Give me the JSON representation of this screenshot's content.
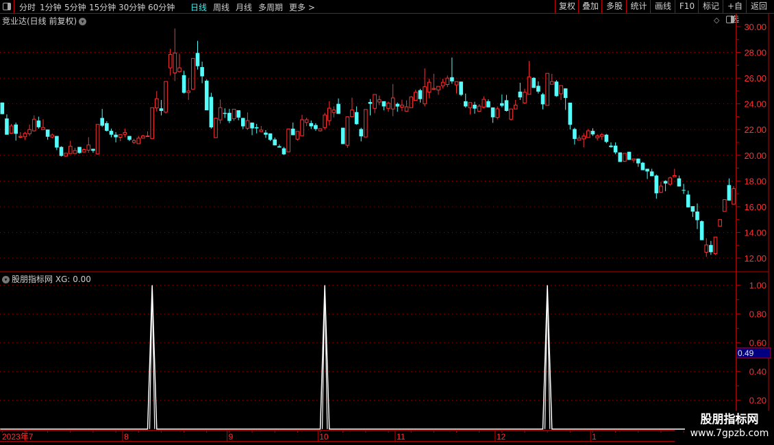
{
  "toolbar": {
    "periods": [
      "分时",
      "1分钟",
      "5分钟",
      "15分钟",
      "30分钟",
      "60分钟",
      "日线",
      "周线",
      "月线",
      "多周期",
      "更多 >"
    ],
    "active_period": "日线",
    "buttons": [
      "复权",
      "叠加",
      "多股",
      "统计",
      "画线",
      "F10",
      "标记",
      "+自选",
      "返回"
    ]
  },
  "chart_title": "竞业达(日线 前复权)",
  "indicator_title": "股朋指标网",
  "indicator_value": "XG: 0.00",
  "cursor_value": "0.49",
  "watermark": {
    "name": "股朋指标网",
    "url": "www.7gpzb.com"
  },
  "colors": {
    "up": "#ff3232",
    "down": "#54fcfc",
    "axis": "#c00000",
    "grid": "#a00000",
    "line": "#ffffff",
    "highlight": "#000080"
  },
  "chart_data": [
    {
      "type": "candlestick",
      "title": "竞业达(日线 前复权)",
      "ylim": [
        12,
        30
      ],
      "yticks": [
        "30.00",
        "28.00",
        "26.00",
        "24.00",
        "22.00",
        "20.00",
        "18.00",
        "16.00",
        "14.00",
        "12.00"
      ],
      "grid": true,
      "ohlc_format": [
        "open",
        "high",
        "low",
        "close"
      ],
      "ohlc": [
        [
          24.1,
          24.1,
          23.2,
          23.2
        ],
        [
          22.86,
          23.18,
          21.6,
          21.6
        ],
        [
          21.72,
          22.44,
          21.67,
          22.28
        ],
        [
          22.39,
          22.54,
          21.14,
          21.67
        ],
        [
          21.4,
          21.8,
          21.33,
          21.47
        ],
        [
          21.44,
          21.82,
          21.19,
          21.7
        ],
        [
          21.67,
          22.39,
          21.5,
          22.0
        ],
        [
          21.9,
          23.1,
          21.85,
          22.8
        ],
        [
          22.7,
          23.0,
          22.07,
          22.18
        ],
        [
          22.0,
          22.8,
          21.95,
          22.16
        ],
        [
          22.0,
          22.0,
          21.2,
          21.44
        ],
        [
          21.42,
          21.7,
          21.3,
          21.58
        ],
        [
          21.5,
          21.5,
          20.4,
          20.6
        ],
        [
          20.65,
          20.7,
          19.9,
          19.95
        ],
        [
          19.93,
          20.16,
          19.9,
          20.16
        ],
        [
          20.14,
          21.12,
          20.14,
          20.7
        ],
        [
          20.14,
          20.58,
          20.14,
          20.37
        ],
        [
          20.65,
          20.65,
          20.12,
          20.18
        ],
        [
          20.25,
          20.54,
          20.25,
          20.44
        ],
        [
          20.4,
          21.4,
          20.2,
          20.8
        ],
        [
          20.5,
          20.5,
          20.2,
          20.35
        ],
        [
          20.1,
          22.4,
          20.05,
          22.4
        ],
        [
          22.9,
          23.6,
          22.2,
          22.3
        ],
        [
          22.5,
          22.65,
          21.85,
          21.9
        ],
        [
          21.9,
          22.07,
          21.4,
          21.6
        ],
        [
          21.6,
          21.8,
          21.0,
          21.4
        ],
        [
          21.4,
          21.6,
          21.1,
          21.6
        ],
        [
          21.63,
          22.07,
          21.4,
          21.77
        ],
        [
          21.5,
          21.5,
          21.1,
          21.2
        ],
        [
          21.0,
          21.28,
          20.9,
          21.14
        ],
        [
          20.9,
          21.5,
          20.9,
          21.33
        ],
        [
          21.33,
          21.6,
          21.33,
          21.5
        ],
        [
          21.47,
          21.86,
          21.47,
          21.5
        ],
        [
          21.3,
          23.7,
          21.3,
          23.7
        ],
        [
          23.68,
          25.0,
          23.4,
          24.4
        ],
        [
          23.65,
          24.3,
          23.1,
          23.45
        ],
        [
          23.35,
          25.74,
          23.25,
          25.74
        ],
        [
          26.8,
          28.28,
          26.2,
          27.84
        ],
        [
          26.4,
          29.86,
          25.77,
          27.95
        ],
        [
          26.5,
          27.9,
          26.45,
          26.8
        ],
        [
          26.23,
          26.58,
          24.8,
          24.86
        ],
        [
          24.88,
          26.0,
          24.3,
          25.0
        ],
        [
          25.14,
          27.53,
          25.14,
          27.53
        ],
        [
          27.96,
          28.9,
          26.67,
          26.93
        ],
        [
          26.86,
          27.28,
          25.6,
          26.14
        ],
        [
          25.8,
          25.9,
          23.5,
          23.5
        ],
        [
          24.54,
          24.86,
          22.07,
          22.17
        ],
        [
          21.37,
          22.93,
          21.37,
          22.88
        ],
        [
          22.75,
          24.33,
          22.46,
          23.7
        ],
        [
          23.3,
          23.65,
          22.9,
          23.22
        ],
        [
          23.3,
          23.6,
          22.5,
          22.67
        ],
        [
          22.84,
          23.58,
          22.67,
          23.58
        ],
        [
          23.5,
          23.5,
          22.72,
          22.93
        ],
        [
          22.9,
          22.9,
          22.04,
          22.25
        ],
        [
          22.1,
          23.33,
          21.97,
          22.7
        ],
        [
          22.54,
          22.54,
          21.56,
          22.09
        ],
        [
          22.18,
          22.44,
          21.7,
          22.09
        ],
        [
          21.84,
          22.28,
          21.84,
          21.96
        ],
        [
          21.76,
          21.96,
          21.35,
          21.6
        ],
        [
          21.7,
          21.7,
          21.1,
          21.2
        ],
        [
          21.23,
          21.38,
          20.77,
          20.77
        ],
        [
          20.7,
          20.84,
          20.6,
          20.6
        ],
        [
          20.54,
          20.65,
          20.03,
          20.07
        ],
        [
          20.26,
          22.05,
          20.26,
          22.05
        ],
        [
          22.07,
          22.54,
          21.56,
          21.56
        ],
        [
          21.25,
          21.86,
          21.14,
          21.86
        ],
        [
          21.52,
          23.15,
          21.5,
          22.76
        ],
        [
          22.55,
          22.92,
          22.27,
          22.76
        ],
        [
          22.5,
          22.7,
          22.04,
          22.25
        ],
        [
          22.35,
          22.5,
          21.9,
          22.04
        ],
        [
          21.9,
          22.07,
          21.84,
          22.07
        ],
        [
          22.16,
          23.3,
          22.0,
          23.13
        ],
        [
          22.7,
          24.2,
          22.32,
          23.66
        ],
        [
          23.33,
          23.8,
          22.94,
          23.52
        ],
        [
          24.0,
          24.42,
          23.22,
          23.22
        ],
        [
          22.14,
          22.14,
          20.87,
          20.87
        ],
        [
          20.78,
          22.99,
          20.57,
          22.99
        ],
        [
          23.0,
          24.48,
          23.0,
          23.52
        ],
        [
          23.36,
          23.8,
          22.37,
          22.42
        ],
        [
          22.04,
          22.14,
          21.08,
          21.47
        ],
        [
          21.42,
          23.56,
          21.42,
          23.56
        ],
        [
          24.14,
          24.37,
          23.1,
          24.0
        ],
        [
          23.65,
          24.73,
          23.27,
          24.73
        ],
        [
          24.14,
          24.64,
          23.9,
          24.32
        ],
        [
          24.2,
          24.2,
          23.5,
          23.8
        ],
        [
          23.65,
          24.17,
          23.38,
          24.05
        ],
        [
          23.6,
          25.54,
          23.04,
          24.46
        ],
        [
          24.0,
          24.1,
          23.38,
          23.79
        ],
        [
          23.75,
          24.32,
          23.43,
          23.9
        ],
        [
          23.43,
          24.27,
          23.43,
          23.77
        ],
        [
          23.7,
          24.6,
          23.7,
          24.53
        ],
        [
          24.27,
          25.1,
          24.25,
          24.9
        ],
        [
          25.06,
          25.17,
          24.1,
          24.37
        ],
        [
          24.0,
          26.76,
          23.8,
          25.33
        ],
        [
          24.92,
          25.96,
          24.44,
          25.68
        ],
        [
          25.13,
          26.34,
          25.13,
          25.2
        ],
        [
          25.08,
          25.36,
          24.7,
          25.36
        ],
        [
          25.4,
          25.95,
          25.2,
          25.68
        ],
        [
          25.5,
          26.2,
          25.3,
          26.0
        ],
        [
          26.07,
          27.6,
          25.56,
          25.75
        ],
        [
          25.47,
          25.73,
          24.8,
          25.73
        ],
        [
          25.73,
          25.73,
          24.6,
          24.7
        ],
        [
          24.2,
          24.8,
          23.7,
          23.8
        ],
        [
          23.7,
          24.1,
          23.17,
          24.1
        ],
        [
          23.93,
          24.16,
          23.23,
          23.63
        ],
        [
          23.42,
          23.98,
          23.42,
          23.82
        ],
        [
          23.75,
          24.58,
          23.63,
          24.35
        ],
        [
          24.2,
          24.35,
          23.73,
          23.73
        ],
        [
          23.72,
          23.72,
          22.52,
          22.95
        ],
        [
          22.94,
          23.8,
          22.79,
          23.61
        ],
        [
          24.05,
          24.72,
          23.73,
          23.85
        ],
        [
          24.28,
          24.7,
          23.4,
          23.45
        ],
        [
          22.8,
          23.6,
          22.7,
          23.6
        ],
        [
          23.6,
          24.3,
          23.6,
          23.9
        ],
        [
          24.95,
          25.64,
          24.3,
          24.5
        ],
        [
          24.07,
          25.17,
          24.0,
          24.9
        ],
        [
          24.74,
          27.34,
          24.74,
          26.1
        ],
        [
          26.02,
          26.07,
          25.24,
          25.24
        ],
        [
          25.4,
          25.75,
          24.8,
          24.95
        ],
        [
          24.74,
          24.85,
          23.57,
          23.96
        ],
        [
          23.88,
          26.37,
          23.88,
          26.37
        ],
        [
          25.52,
          26.34,
          25.52,
          25.73
        ],
        [
          25.73,
          25.84,
          24.55,
          24.6
        ],
        [
          24.78,
          25.42,
          24.3,
          25.42
        ],
        [
          25.2,
          25.2,
          23.53,
          24.46
        ],
        [
          24.09,
          24.09,
          22.0,
          22.37
        ],
        [
          22.04,
          22.14,
          20.83,
          21.27
        ],
        [
          21.17,
          21.56,
          21.17,
          21.33
        ],
        [
          21.27,
          21.72,
          20.62,
          21.49
        ],
        [
          21.38,
          22.04,
          21.38,
          21.9
        ],
        [
          21.9,
          22.1,
          21.5,
          21.62
        ],
        [
          21.36,
          21.63,
          21.15,
          21.5
        ],
        [
          21.47,
          21.72,
          21.2,
          21.6
        ],
        [
          21.6,
          21.66,
          20.94,
          21.04
        ],
        [
          20.75,
          21.0,
          20.59,
          20.64
        ],
        [
          20.75,
          21.0,
          20.08,
          20.22
        ],
        [
          20.22,
          20.22,
          19.48,
          19.48
        ],
        [
          19.53,
          20.15,
          19.48,
          20.15
        ],
        [
          20.27,
          20.27,
          19.64,
          19.64
        ],
        [
          19.62,
          19.72,
          19.42,
          19.72
        ],
        [
          19.74,
          19.74,
          19.1,
          19.37
        ],
        [
          19.42,
          19.48,
          18.84,
          18.84
        ],
        [
          18.95,
          18.95,
          18.15,
          18.74
        ],
        [
          18.74,
          18.95,
          18.37,
          18.37
        ],
        [
          18.42,
          18.5,
          16.62,
          17.04
        ],
        [
          17.11,
          17.94,
          17.06,
          17.6
        ],
        [
          18.0,
          18.05,
          17.2,
          17.8
        ],
        [
          17.75,
          18.33,
          17.64,
          18.24
        ],
        [
          18.33,
          18.95,
          18.33,
          18.42
        ],
        [
          18.2,
          18.42,
          17.57,
          17.57
        ],
        [
          17.3,
          17.78,
          16.99,
          17.27
        ],
        [
          16.94,
          17.25,
          15.95,
          15.95
        ],
        [
          16.04,
          16.04,
          15.2,
          15.62
        ],
        [
          15.62,
          16.25,
          14.26,
          14.95
        ],
        [
          14.87,
          14.93,
          13.4,
          13.4
        ],
        [
          12.46,
          13.55,
          12.09,
          13.02
        ],
        [
          13.02,
          13.34,
          12.25,
          12.46
        ],
        [
          12.35,
          13.64,
          12.25,
          13.64
        ],
        [
          14.49,
          15.0,
          14.49,
          15.0
        ],
        [
          15.63,
          16.55,
          15.63,
          16.55
        ],
        [
          17.68,
          18.2,
          16.48,
          16.48
        ],
        [
          16.2,
          17.6,
          16.17,
          17.4
        ]
      ]
    },
    {
      "type": "line",
      "title": "股朋指标网",
      "series": [
        {
          "name": "XG",
          "signal_bars": [
            34,
            72,
            121
          ],
          "signal_value": 1,
          "base_value": 0
        }
      ],
      "ylim": [
        0,
        1.1
      ],
      "yticks": [
        "1.00",
        "0.80",
        "0.60",
        "0.40",
        "0.20"
      ],
      "grid": true
    }
  ],
  "date_axis": {
    "labels": [
      "2023年7",
      "8",
      "9",
      "10",
      "11",
      "12",
      "1"
    ],
    "label_bars": [
      1,
      28,
      51,
      71,
      88,
      110,
      131
    ]
  }
}
